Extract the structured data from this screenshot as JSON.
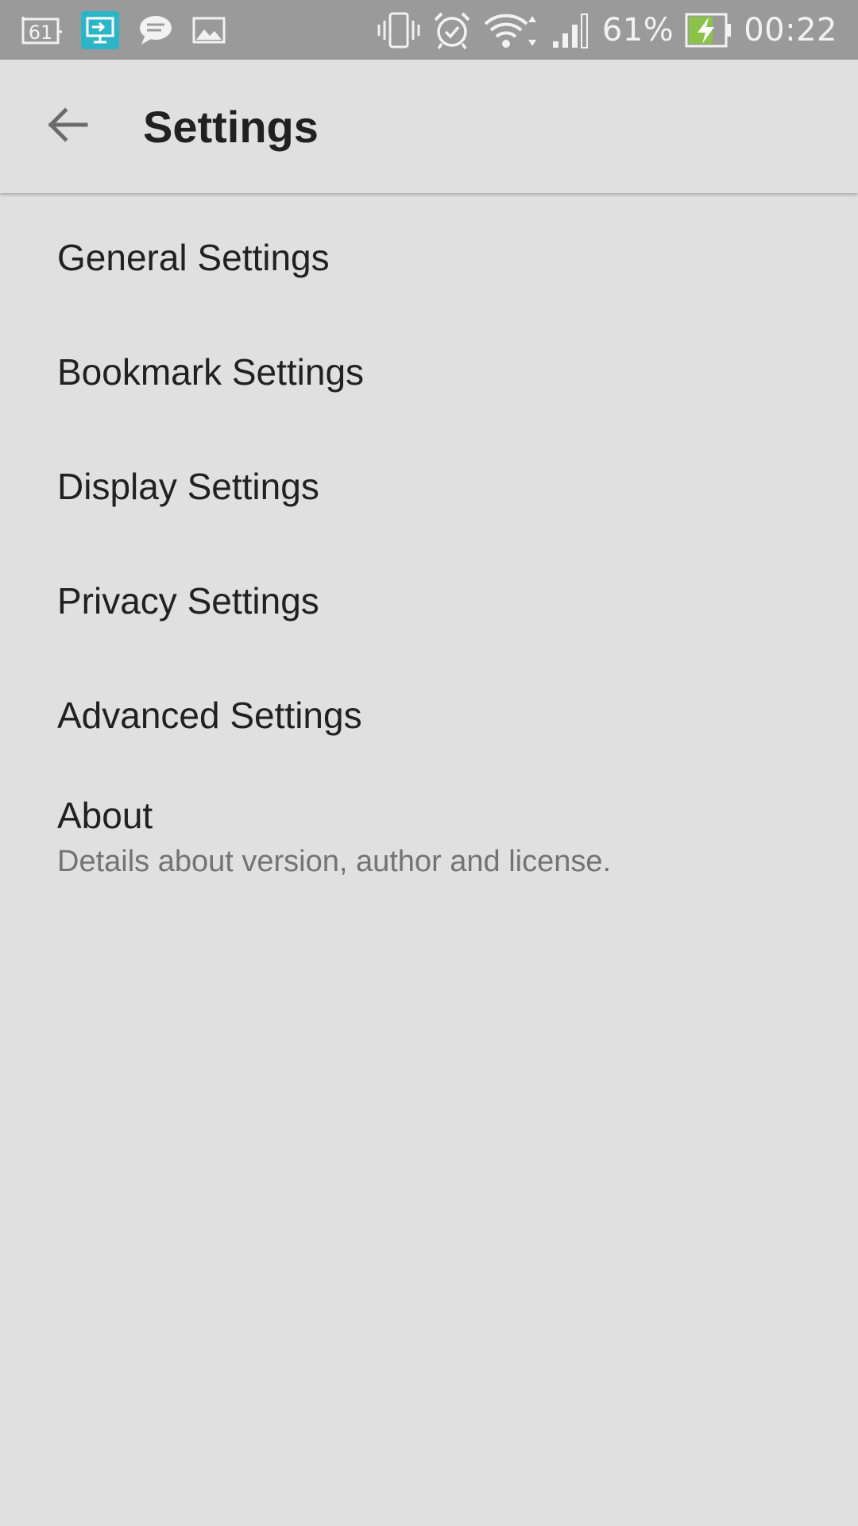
{
  "status_bar": {
    "left_icons": [
      "calendar-icon",
      "screen-mirror-icon",
      "message-icon",
      "image-icon"
    ],
    "calendar_day": "61",
    "right_icons": [
      "vibrate-icon",
      "alarm-icon",
      "wifi-icon",
      "signal-icon",
      "battery-charging-icon"
    ],
    "battery_percent": "61%",
    "time": "00:22",
    "colors": {
      "background": "#9a9a9a",
      "icon": "#f2f2f2",
      "accent": "#2bb5c7",
      "battery": "#8bc34a"
    }
  },
  "app_bar": {
    "back_icon": "arrow-back-icon",
    "title": "Settings"
  },
  "settings": {
    "items": [
      {
        "title": "General Settings"
      },
      {
        "title": "Bookmark Settings"
      },
      {
        "title": "Display Settings"
      },
      {
        "title": "Privacy Settings"
      },
      {
        "title": "Advanced Settings"
      },
      {
        "title": "About",
        "summary": "Details about version, author and license."
      }
    ]
  }
}
